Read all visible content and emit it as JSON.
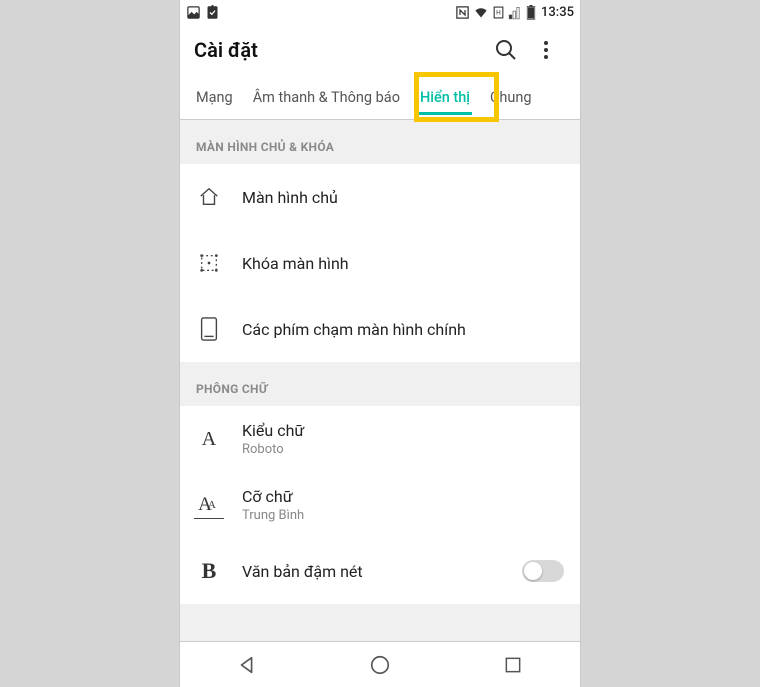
{
  "statusbar": {
    "time": "13:35"
  },
  "titlebar": {
    "title": "Cài đặt"
  },
  "tabs": [
    {
      "label": "Mạng",
      "active": false
    },
    {
      "label": "Âm thanh & Thông báo",
      "active": false
    },
    {
      "label": "Hiển thị",
      "active": true
    },
    {
      "label": "Chung",
      "active": false
    }
  ],
  "sections": [
    {
      "header": "MÀN HÌNH CHỦ & KHÓA",
      "items": [
        {
          "title": "Màn hình chủ",
          "icon": "home-icon"
        },
        {
          "title": "Khóa màn hình",
          "icon": "lock-frame-icon"
        },
        {
          "title": "Các phím chạm màn hình chính",
          "icon": "phone-outline-icon"
        }
      ]
    },
    {
      "header": "PHÔNG CHỮ",
      "items": [
        {
          "title": "Kiểu chữ",
          "subtitle": "Roboto",
          "icon": "font-a-icon"
        },
        {
          "title": "Cỡ chữ",
          "subtitle": "Trung Bình",
          "icon": "font-aa-icon"
        },
        {
          "title": "Văn bản đậm nét",
          "icon": "font-b-icon",
          "toggle": false
        }
      ]
    }
  ]
}
